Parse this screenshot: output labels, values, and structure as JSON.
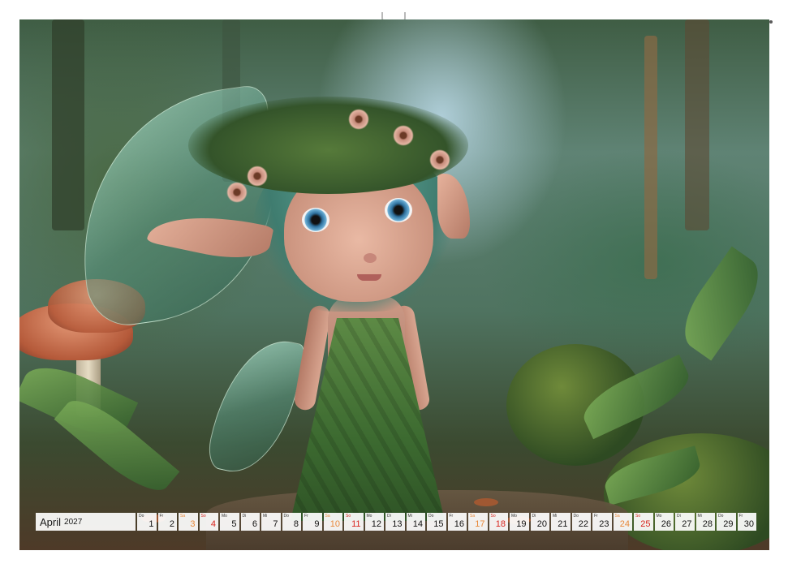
{
  "calendar": {
    "month": "April",
    "year": "2027",
    "days": [
      {
        "weekday": "Do",
        "day": "1",
        "type": "weekday"
      },
      {
        "weekday": "Fr",
        "day": "2",
        "type": "weekday"
      },
      {
        "weekday": "Sa",
        "day": "3",
        "type": "saturday"
      },
      {
        "weekday": "So",
        "day": "4",
        "type": "sunday"
      },
      {
        "weekday": "Mo",
        "day": "5",
        "type": "weekday"
      },
      {
        "weekday": "Di",
        "day": "6",
        "type": "weekday"
      },
      {
        "weekday": "Mi",
        "day": "7",
        "type": "weekday"
      },
      {
        "weekday": "Do",
        "day": "8",
        "type": "weekday"
      },
      {
        "weekday": "Fr",
        "day": "9",
        "type": "weekday"
      },
      {
        "weekday": "Sa",
        "day": "10",
        "type": "saturday"
      },
      {
        "weekday": "So",
        "day": "11",
        "type": "sunday"
      },
      {
        "weekday": "Mo",
        "day": "12",
        "type": "weekday"
      },
      {
        "weekday": "Di",
        "day": "13",
        "type": "weekday"
      },
      {
        "weekday": "Mi",
        "day": "14",
        "type": "weekday"
      },
      {
        "weekday": "Do",
        "day": "15",
        "type": "weekday"
      },
      {
        "weekday": "Fr",
        "day": "16",
        "type": "weekday"
      },
      {
        "weekday": "Sa",
        "day": "17",
        "type": "saturday"
      },
      {
        "weekday": "So",
        "day": "18",
        "type": "sunday"
      },
      {
        "weekday": "Mo",
        "day": "19",
        "type": "weekday"
      },
      {
        "weekday": "Di",
        "day": "20",
        "type": "weekday"
      },
      {
        "weekday": "Mi",
        "day": "21",
        "type": "weekday"
      },
      {
        "weekday": "Do",
        "day": "22",
        "type": "weekday"
      },
      {
        "weekday": "Fr",
        "day": "23",
        "type": "weekday"
      },
      {
        "weekday": "Sa",
        "day": "24",
        "type": "saturday"
      },
      {
        "weekday": "So",
        "day": "25",
        "type": "sunday"
      },
      {
        "weekday": "Mo",
        "day": "26",
        "type": "weekday"
      },
      {
        "weekday": "Di",
        "day": "27",
        "type": "weekday"
      },
      {
        "weekday": "Mi",
        "day": "28",
        "type": "weekday"
      },
      {
        "weekday": "Do",
        "day": "29",
        "type": "weekday"
      },
      {
        "weekday": "Fr",
        "day": "30",
        "type": "weekday"
      }
    ]
  },
  "colors": {
    "saturday": "#e8893a",
    "sunday": "#d8241d",
    "weekday": "#111111",
    "binding_ring": "#5b5b5b"
  },
  "image": {
    "subject_icon": "fairy-illustration"
  }
}
